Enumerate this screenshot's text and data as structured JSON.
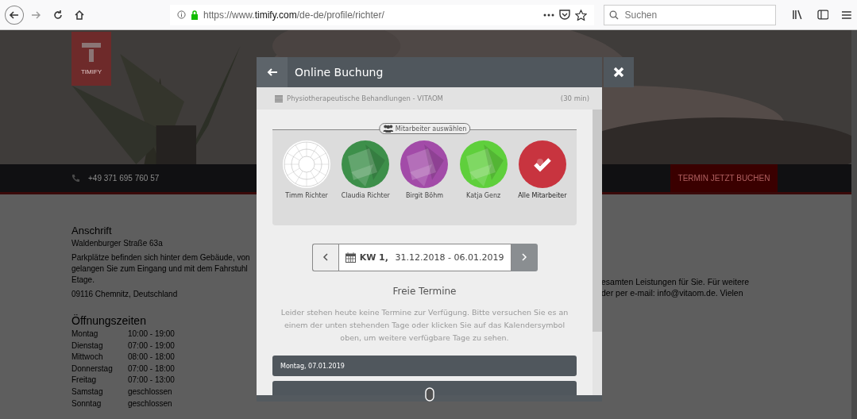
{
  "browser": {
    "url": {
      "prefix": "https://www.",
      "domain": "timify.com",
      "path": "/de-de/profile/richter/"
    },
    "search": {
      "placeholder": "Suchen"
    }
  },
  "page": {
    "logo": "TIMIFY",
    "phone": "+49 371 695 760 57",
    "book_button": "TERMIN JETZT BUCHEN",
    "address": {
      "title": "Anschrift",
      "street": "Waldenburger Straße 63a",
      "parking_lines": [
        "Parkplätze befinden sich hinter dem Gebäude, von",
        "gelangen Sie zum Eingang und mit dem Fahrstuhl",
        "Etage."
      ],
      "city": "09116 Chemnitz, Deutschland"
    },
    "hours": {
      "title": "Öffnungszeiten",
      "rows": [
        {
          "day": "Montag",
          "time": "10:00 - 19:00"
        },
        {
          "day": "Dienstag",
          "time": "07:00 - 19:00"
        },
        {
          "day": "Mittwoch",
          "time": "08:00 - 18:00"
        },
        {
          "day": "Donnerstag",
          "time": "07:00 - 18:00"
        },
        {
          "day": "Freitag",
          "time": "07:00 - 13:00"
        },
        {
          "day": "Samstag",
          "time": "geschlossen"
        },
        {
          "day": "Sonntag",
          "time": "geschlossen"
        }
      ]
    },
    "info_lines": [
      "esamten Leistungen für Sie. Für weitere",
      "der per e-mail: info@vitaom.de. Vielen"
    ]
  },
  "modal": {
    "title": "Online Buchung",
    "service": "Physiotherapeutische Behandlungen - VITAOM",
    "duration": "(30 min)",
    "staff_legend": "Mitarbeiter auswählen",
    "staff": [
      {
        "name": "Timm Richter",
        "kind": "wheel",
        "color": "#ffffff",
        "selected": false
      },
      {
        "name": "Claudia Richter",
        "kind": "facets",
        "color": "#3d8f4a",
        "selected": false
      },
      {
        "name": "Birgit Böhm",
        "kind": "facets",
        "color": "#a24ba8",
        "selected": false
      },
      {
        "name": "Katja Genz",
        "kind": "facets",
        "color": "#5fcf3c",
        "selected": false
      },
      {
        "name": "Alle Mitarbeiter",
        "kind": "all",
        "color": "#c8343f",
        "selected": true
      }
    ],
    "week": {
      "label": "KW 1,",
      "range": "31.12.2018 - 06.01.2019"
    },
    "free_title": "Freie Termine",
    "notice": "Leider stehen heute keine Termine zur Verfügung. Bitte versuchen Sie es an einem der unten stehenden Tage oder klicken Sie auf das Kalendersymbol oben, um weitere verfügbare Tage zu sehen.",
    "days": [
      "Montag, 07.01.2019"
    ]
  }
}
